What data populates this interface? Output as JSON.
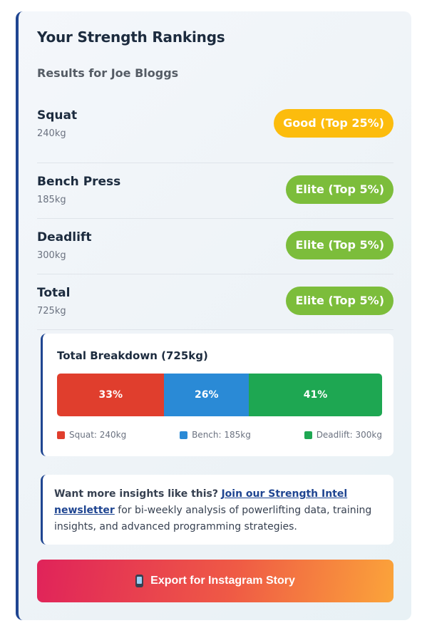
{
  "card": {
    "title": "Your Strength Rankings",
    "subtitle": "Results for Joe Bloggs"
  },
  "rankings": [
    {
      "lift": "Squat",
      "weight": "240kg",
      "badge": "Good (Top 25%)",
      "badge_color": "#fcbc0d"
    },
    {
      "lift": "Bench Press",
      "weight": "185kg",
      "badge": "Elite (Top 5%)",
      "badge_color": "#7cbd3b"
    },
    {
      "lift": "Deadlift",
      "weight": "300kg",
      "badge": "Elite (Top 5%)",
      "badge_color": "#7cbd3b"
    },
    {
      "lift": "Total",
      "weight": "725kg",
      "badge": "Elite (Top 5%)",
      "badge_color": "#7cbd3b"
    }
  ],
  "breakdown": {
    "title": "Total Breakdown (725kg)",
    "segments": [
      {
        "label": "33%",
        "value": 33,
        "color": "#e03e2d",
        "legend": "Squat: 240kg"
      },
      {
        "label": "26%",
        "value": 26,
        "color": "#2a8ad6",
        "legend": "Bench: 185kg"
      },
      {
        "label": "41%",
        "value": 41,
        "color": "#1ea752",
        "legend": "Deadlift: 300kg"
      }
    ]
  },
  "insights": {
    "lead": "Want more insights like this?",
    "link": "Join our Strength Intel newsletter",
    "rest": "for bi-weekly analysis of powerlifting data, training insights, and advanced programming strategies."
  },
  "export": {
    "label": "Export for Instagram Story",
    "icon": "mobile-phone-icon"
  },
  "colors": {
    "accent": "#1f4591",
    "good": "#fcbc0d",
    "elite": "#7cbd3b"
  }
}
